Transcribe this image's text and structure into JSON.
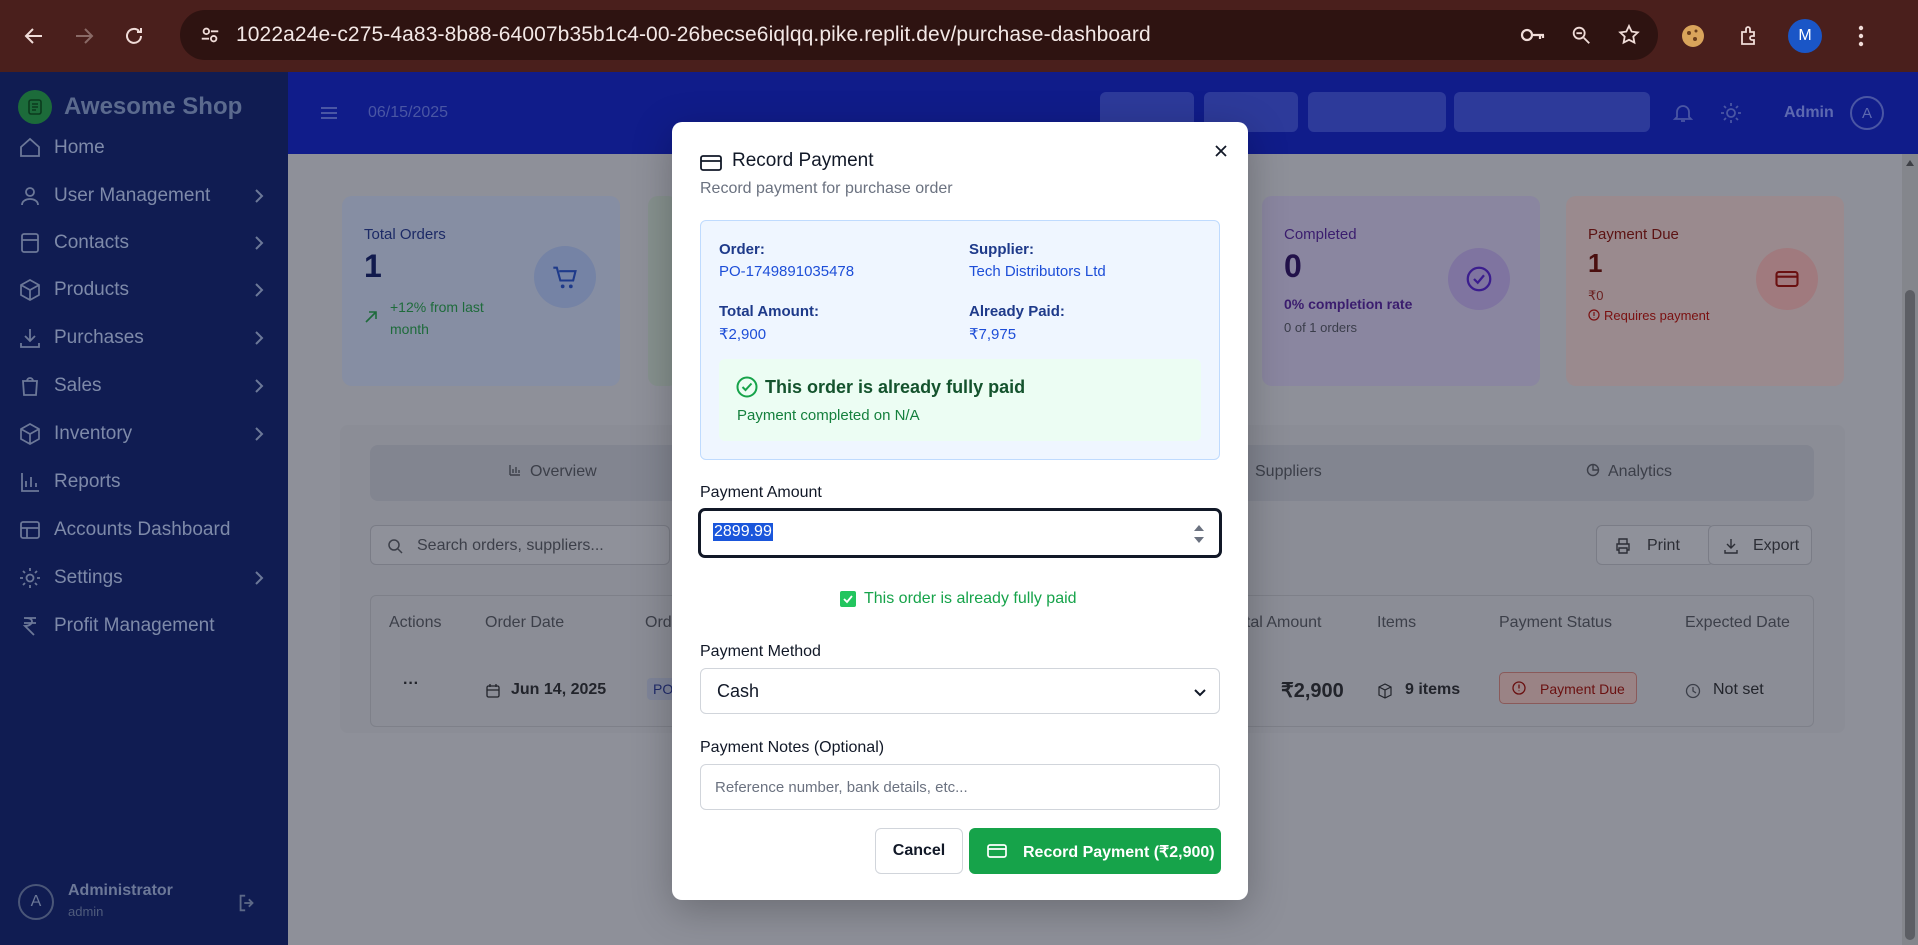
{
  "browser": {
    "url": "1022a24e-c275-4a83-8b88-64007b35b1c4-00-26becse6iqlqq.pike.replit.dev/purchase-dashboard",
    "profile_initial": "M"
  },
  "app": {
    "brand": "Awesome Shop",
    "date": "06/15/2025",
    "admin_label": "Admin",
    "admin_initial": "A"
  },
  "sidebar": {
    "items": [
      {
        "label": "Home",
        "icon": "home-icon"
      },
      {
        "label": "User Management",
        "icon": "user-icon"
      },
      {
        "label": "Contacts",
        "icon": "contacts-icon"
      },
      {
        "label": "Products",
        "icon": "box-icon"
      },
      {
        "label": "Purchases",
        "icon": "download-icon"
      },
      {
        "label": "Sales",
        "icon": "bag-icon"
      },
      {
        "label": "Inventory",
        "icon": "box-icon"
      },
      {
        "label": "Reports",
        "icon": "bar-chart-icon"
      },
      {
        "label": "Accounts Dashboard",
        "icon": "accounts-icon"
      },
      {
        "label": "Settings",
        "icon": "gear-icon"
      },
      {
        "label": "Profit Management",
        "icon": "rupee-icon"
      }
    ],
    "user": {
      "name": "Administrator",
      "role": "admin",
      "initial": "A"
    }
  },
  "cards": [
    {
      "title": "Total Orders",
      "value": "1",
      "sub": "+12% from last month"
    },
    {
      "title": "Completed",
      "value": "0",
      "sub": "0% completion rate",
      "sub2": "0 of 1 orders"
    },
    {
      "title": "Payment Due",
      "value": "1",
      "sub": "₹0",
      "sub2": "Requires payment"
    }
  ],
  "tabs": [
    "Overview",
    "Suppliers",
    "Analytics"
  ],
  "search_placeholder": "Search orders, suppliers...",
  "toolbar": {
    "print": "Print",
    "export": "Export"
  },
  "table": {
    "headers": [
      "Actions",
      "Order Date",
      "Ord",
      "otal Amount",
      "Items",
      "Payment Status",
      "Expected Date"
    ],
    "row": {
      "actions": "···",
      "date": "Jun 14, 2025",
      "order": "PO",
      "amount": "₹2,900",
      "items": "9 items",
      "status": "Payment Due",
      "expected": "Not set"
    }
  },
  "modal": {
    "title": "Record Payment",
    "description": "Record payment for purchase order",
    "order_label": "Order:",
    "order_value": "PO-1749891035478",
    "supplier_label": "Supplier:",
    "supplier_value": "Tech Distributors Ltd",
    "total_label": "Total Amount:",
    "total_value": "₹2,900",
    "paid_label": "Already Paid:",
    "paid_value": "₹7,975",
    "paid_notice_title": "This order is already fully paid",
    "paid_notice_sub": "Payment completed on N/A",
    "amount_label": "Payment Amount",
    "amount_value": "2899.99",
    "amount_msg": "This order is already fully paid",
    "method_label": "Payment Method",
    "method_value": "Cash",
    "notes_label": "Payment Notes (Optional)",
    "notes_placeholder": "Reference number, bank details, etc...",
    "cancel": "Cancel",
    "record": "Record Payment (₹2,900)"
  },
  "colors": {
    "primary_green": "#16a34a",
    "sidebar_bg": "#101c52",
    "topbar_bg": "#101c8a",
    "browser_bar": "#4a1f1c"
  }
}
